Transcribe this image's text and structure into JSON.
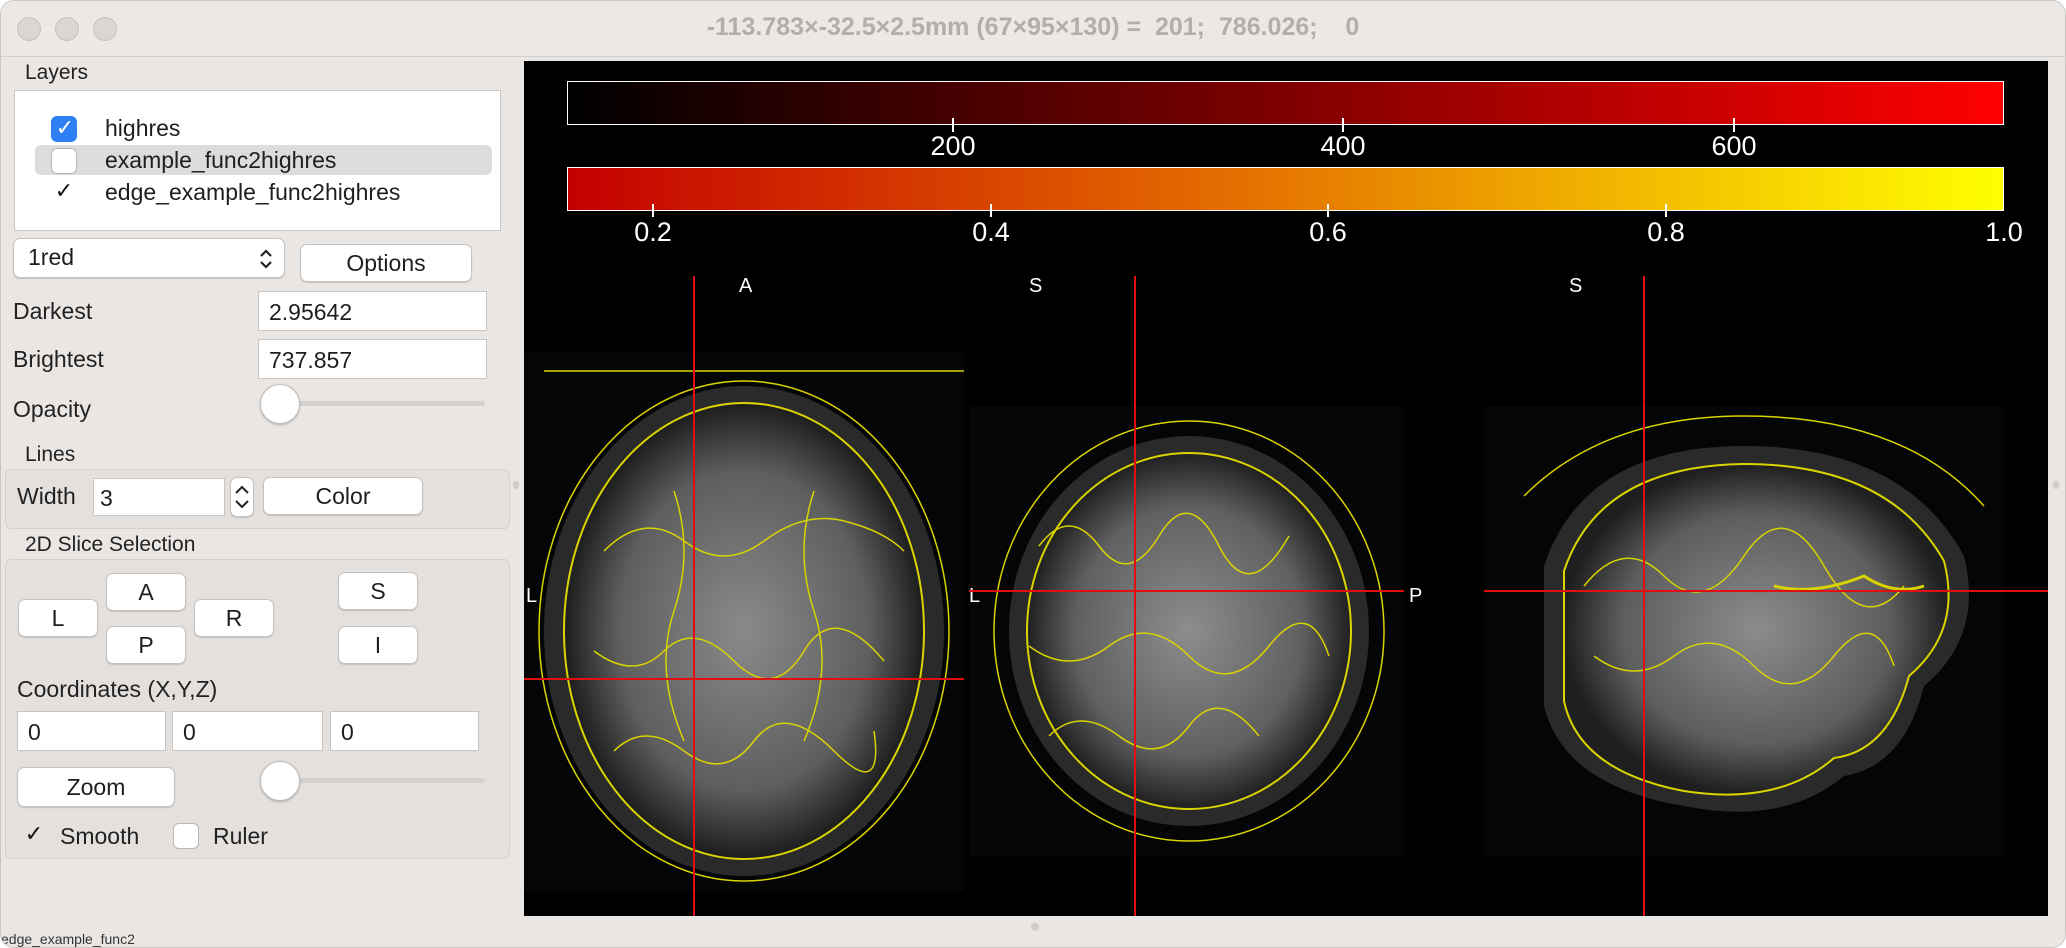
{
  "window": {
    "title": "-113.783×-32.5×2.5mm (67×95×130) =  201;  786.026;    0"
  },
  "layers_panel": {
    "title": "Layers",
    "items": [
      {
        "label": "highres",
        "checked": true,
        "selected": false
      },
      {
        "label": "example_func2highres",
        "checked": false,
        "selected": true
      },
      {
        "label": "edge_example_func2highres",
        "checked": true,
        "selected": false
      }
    ]
  },
  "colormap": {
    "selected": "1red",
    "options_label": "Options"
  },
  "intensity": {
    "darkest_label": "Darkest",
    "darkest_value": "2.95642",
    "brightest_label": "Brightest",
    "brightest_value": "737.857",
    "opacity_label": "Opacity",
    "opacity_level": 0
  },
  "lines": {
    "title": "Lines",
    "width_label": "Width",
    "width_value": "3",
    "color_label": "Color"
  },
  "slice_selection": {
    "title": "2D Slice Selection",
    "buttons": {
      "L": "L",
      "A": "A",
      "R": "R",
      "P": "P",
      "S": "S",
      "I": "I"
    },
    "coordinates_label": "Coordinates (X,Y,Z)",
    "x": "0",
    "y": "0",
    "z": "0",
    "zoom_label": "Zoom",
    "zoom_level": 0,
    "smooth_label": "Smooth",
    "smooth_checked": true,
    "ruler_label": "Ruler",
    "ruler_checked": false
  },
  "viewer": {
    "colorbar_top": {
      "ticks": [
        "200",
        "400",
        "600"
      ],
      "colors": [
        "#000000",
        "#ff0000"
      ]
    },
    "colorbar_bottom": {
      "ticks": [
        "0.2",
        "0.4",
        "0.6",
        "0.8",
        "1.0"
      ],
      "colors": [
        "#c40000",
        "#ffff00"
      ]
    },
    "axial": {
      "top": "A",
      "left": "L"
    },
    "coronal": {
      "top": "S",
      "left": "L",
      "right": "P"
    },
    "sagittal": {
      "top": "S"
    },
    "crosshair_color": "#e01010",
    "edge_color": "#d9d400"
  },
  "status_fragment": "edge_example_func2"
}
